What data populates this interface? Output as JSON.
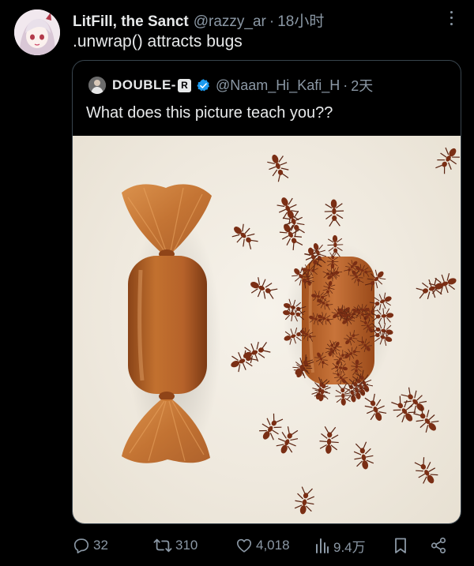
{
  "tweet": {
    "display_name": "LitFill, the Sanct",
    "handle": "@razzy_ar",
    "separator": "·",
    "time": "18小时",
    "text": ".unwrap() attracts bugs",
    "avatar_icon": "anime-avatar-icon",
    "more_icon": "more-options-icon"
  },
  "quote": {
    "display_name": "DOUBLE-",
    "badge": "R",
    "handle": "@Naam_Hi_Kafi_H",
    "separator": "·",
    "time": "2天",
    "text": "What does this picture teach you??",
    "verified_color": "#1d9bf0"
  },
  "actions": {
    "replies": "32",
    "retweets": "310",
    "likes": "4,018",
    "views": "9.4万"
  },
  "colors": {
    "background": "#000000",
    "primary_text": "#e7e9ea",
    "secondary_text": "#8b98a5",
    "border": "#38444d",
    "candy": "#b8652a"
  }
}
